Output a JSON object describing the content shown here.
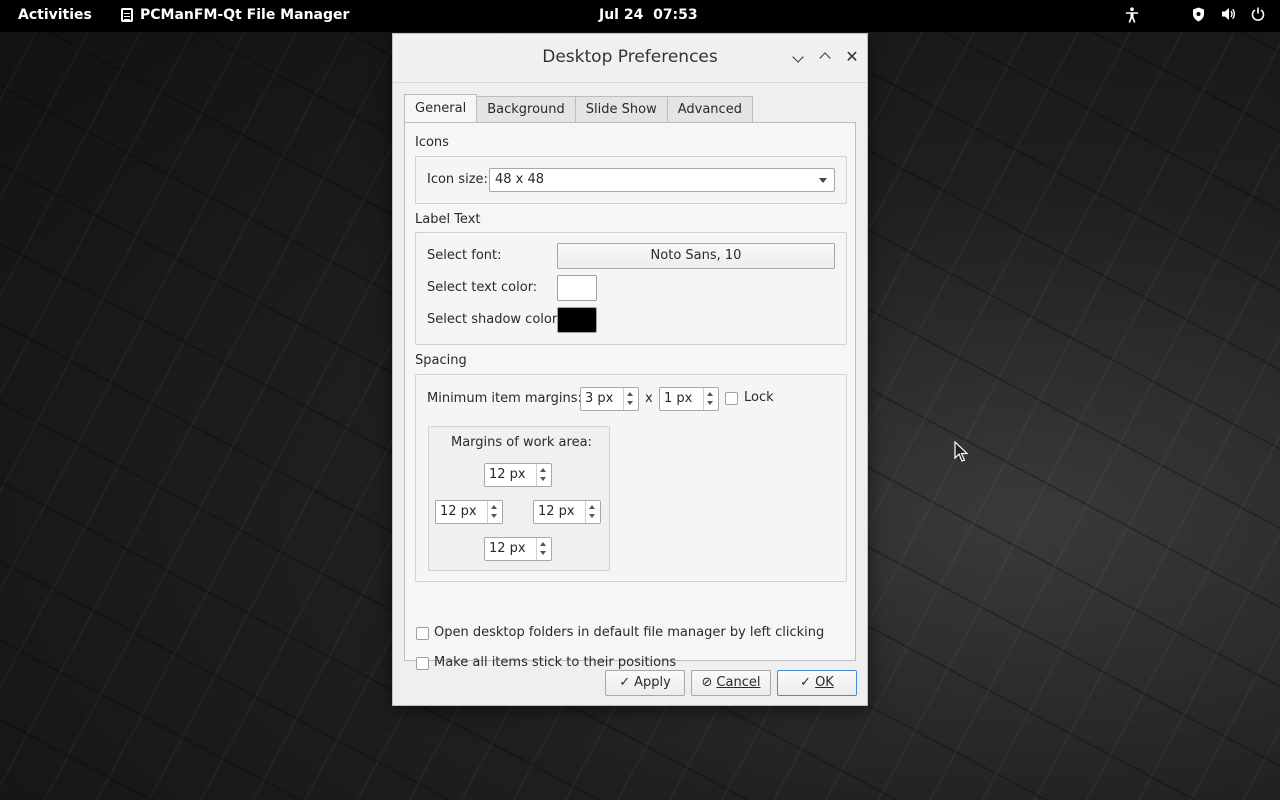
{
  "topbar": {
    "activities": "Activities",
    "app_name": "PCManFM-Qt File Manager",
    "clock": "Jul 24  07:53"
  },
  "dialog": {
    "title": "Desktop Preferences",
    "tabs": [
      {
        "label": "General",
        "active": true
      },
      {
        "label": "Background",
        "active": false
      },
      {
        "label": "Slide Show",
        "active": false
      },
      {
        "label": "Advanced",
        "active": false
      }
    ],
    "icons": {
      "section": "Icons",
      "icon_size_label": "Icon size:",
      "icon_size_value": "48 x 48"
    },
    "label_text": {
      "section": "Label Text",
      "font_label": "Select font:",
      "font_value": "Noto Sans,  10",
      "text_color_label": "Select text color:",
      "text_color": "#ffffff",
      "shadow_color_label": "Select shadow color:",
      "shadow_color": "#000000"
    },
    "spacing": {
      "section": "Spacing",
      "min_margins_label": "Minimum item margins:",
      "margin_x": "3 px",
      "x_sep": "x",
      "margin_y": "1 px",
      "lock_label": "Lock",
      "lock_checked": false,
      "work_area_label": "Margins of work area:",
      "work_top": "12 px",
      "work_left": "12 px",
      "work_right": "12 px",
      "work_bottom": "12 px"
    },
    "options": {
      "open_folders_label": "Open desktop folders in default file manager by left clicking",
      "open_folders_checked": false,
      "stick_label": "Make all items stick to their positions",
      "stick_checked": false
    },
    "buttons": {
      "apply": "Apply",
      "cancel": "Cancel",
      "ok": "OK"
    }
  }
}
